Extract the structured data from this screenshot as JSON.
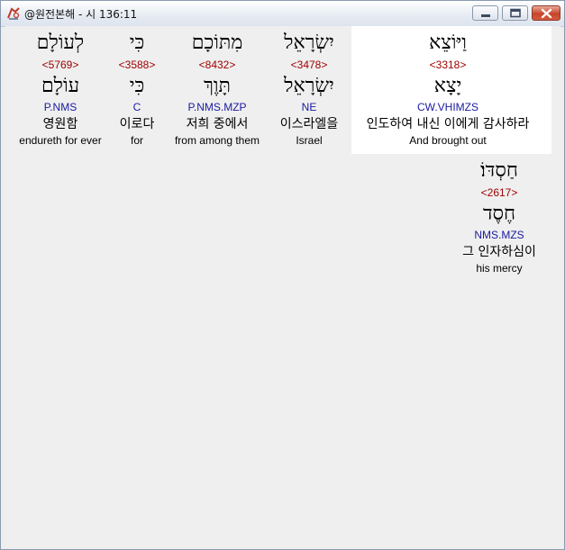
{
  "window": {
    "title": "@원전본해 - 시 136:11",
    "buttons": {
      "minimize": "minimize",
      "maximize": "maximize",
      "close": "close"
    }
  },
  "words": [
    {
      "hebrew": "וַיּוֹצֵא",
      "strong": "<3318>",
      "lemma": "יָצָא",
      "parsing": "CW.VHIMZS",
      "korean": "인도하여 내신 이에게 감사하라",
      "english": "And brought out",
      "selected": true
    },
    {
      "hebrew": "יִשְׂרָאֵל",
      "strong": "<3478>",
      "lemma": "יִשְׂרָאֵל",
      "parsing": "NE",
      "korean": "이스라엘을",
      "english": "Israel"
    },
    {
      "hebrew": "מִתּוֹכָם",
      "strong": "<8432>",
      "lemma": "תָּוֶךְ",
      "parsing": "P.NMS.MZP",
      "korean": "저희 중에서",
      "english": "from among them"
    },
    {
      "hebrew": "כִּי",
      "strong": "<3588>",
      "lemma": "כִּי",
      "parsing": "C",
      "korean": "이로다",
      "english": "for"
    },
    {
      "hebrew": "לְעוֹלָם",
      "strong": "<5769>",
      "lemma": "עוֹלָם",
      "parsing": "P.NMS",
      "korean": "영원함",
      "english": "endureth for ever"
    },
    {
      "hebrew": "חַסְדּוֹ׃",
      "strong": "<2617>",
      "lemma": "חֶסֶד",
      "parsing": "NMS.MZS",
      "korean": "그 인자하심이",
      "english": "his mercy"
    }
  ]
}
